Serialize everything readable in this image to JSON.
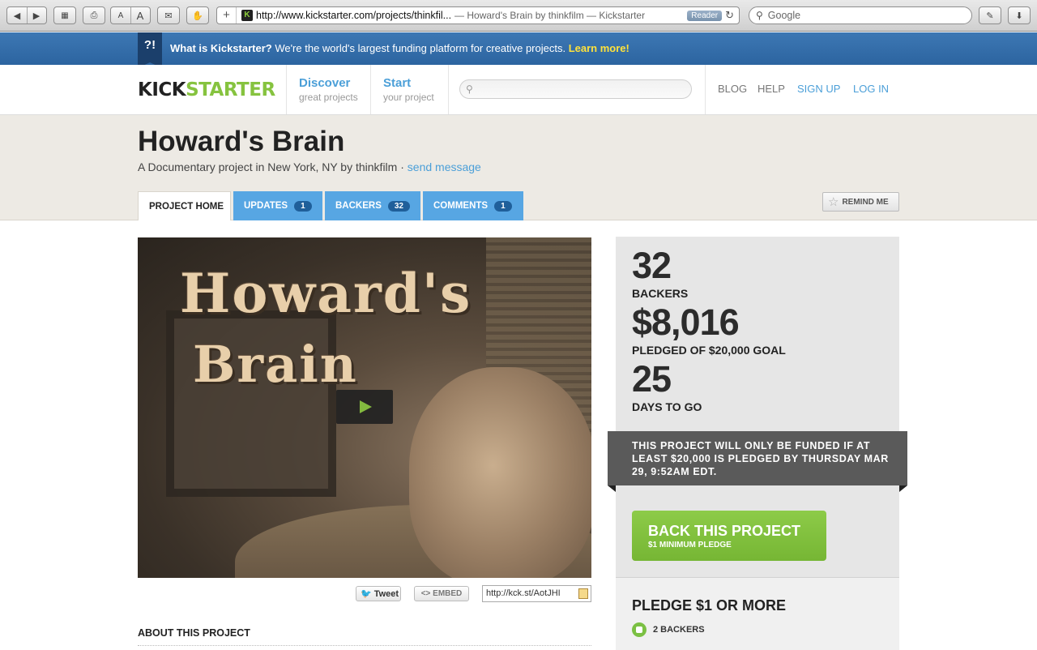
{
  "browser": {
    "url": "http://www.kickstarter.com/projects/thinkfil...",
    "page_title": "— Howard's Brain by thinkfilm — Kickstarter",
    "reader_label": "Reader",
    "search_placeholder": "Google",
    "font_small": "A",
    "font_large": "A"
  },
  "banner": {
    "flag": "?!",
    "lead": "What is Kickstarter?",
    "text": " We're the world's largest funding platform for creative projects. ",
    "learn_more": "Learn more!"
  },
  "header": {
    "logo_part1": "KICK",
    "logo_part2": "STARTER",
    "discover_title": "Discover",
    "discover_sub": "great projects",
    "start_title": "Start",
    "start_sub": "your project",
    "links": [
      "BLOG",
      "HELP",
      "SIGN UP",
      "LOG IN"
    ]
  },
  "project": {
    "title": "Howard's Brain",
    "subtitle": "A Documentary project in New York, NY by thinkfilm · ",
    "send_message": "send message",
    "tabs": [
      {
        "label": "PROJECT HOME",
        "count": ""
      },
      {
        "label": "UPDATES",
        "count": "1"
      },
      {
        "label": "BACKERS",
        "count": "32"
      },
      {
        "label": "COMMENTS",
        "count": "1"
      }
    ],
    "remind_me": "REMIND ME"
  },
  "video": {
    "title_line1": "Howard's",
    "title_line2": "Brain"
  },
  "share": {
    "tweet": "Tweet",
    "embed": "<> EMBED",
    "short_url": "http://kck.st/AotJHI"
  },
  "about_heading": "ABOUT THIS PROJECT",
  "stats": {
    "backers_value": "32",
    "backers_label": "BACKERS",
    "pledged_value": "$8,016",
    "pledged_label": "PLEDGED OF $20,000 GOAL",
    "days_value": "25",
    "days_label": "DAYS TO GO",
    "notice": "THIS PROJECT WILL ONLY BE FUNDED IF AT LEAST $20,000 IS PLEDGED BY THURSDAY MAR 29, 9:52AM EDT.",
    "back_button": "BACK THIS PROJECT",
    "back_sub": "$1 MINIMUM PLEDGE"
  },
  "reward": {
    "title": "PLEDGE $1 OR MORE",
    "backers": "2 BACKERS"
  },
  "colors": {
    "banner_blue": "#2f68a4",
    "link_blue": "#4b9fd8",
    "kickstarter_green": "#86c33f",
    "tab_blue": "#57a6e3"
  }
}
